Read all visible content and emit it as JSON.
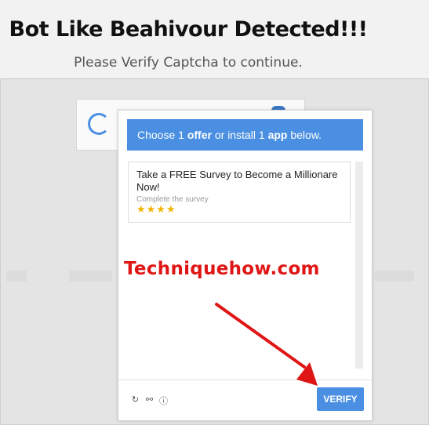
{
  "header": {
    "title": "Bot Like Beahivour Detected!!!",
    "subtitle": "Please Verify Captcha to continue."
  },
  "offer_panel": {
    "bar_prefix": "Choose ",
    "bar_num1": "1",
    "bar_word1": "offer",
    "bar_mid": " or install ",
    "bar_num2": "1",
    "bar_word2": "app",
    "bar_suffix": " below.",
    "card": {
      "title": "Take a FREE Survey to Become a Millionare Now!",
      "subtitle": "Complete the survey",
      "stars": "★★★★"
    },
    "footer_icons": [
      "refresh-icon",
      "headphones-icon",
      "info-icon"
    ],
    "verify_label": "VERIFY"
  },
  "watermark": "Techniquehow.com",
  "colors": {
    "accent": "#4a8fe1",
    "watermark": "#e01515",
    "stars": "#f0b400"
  }
}
